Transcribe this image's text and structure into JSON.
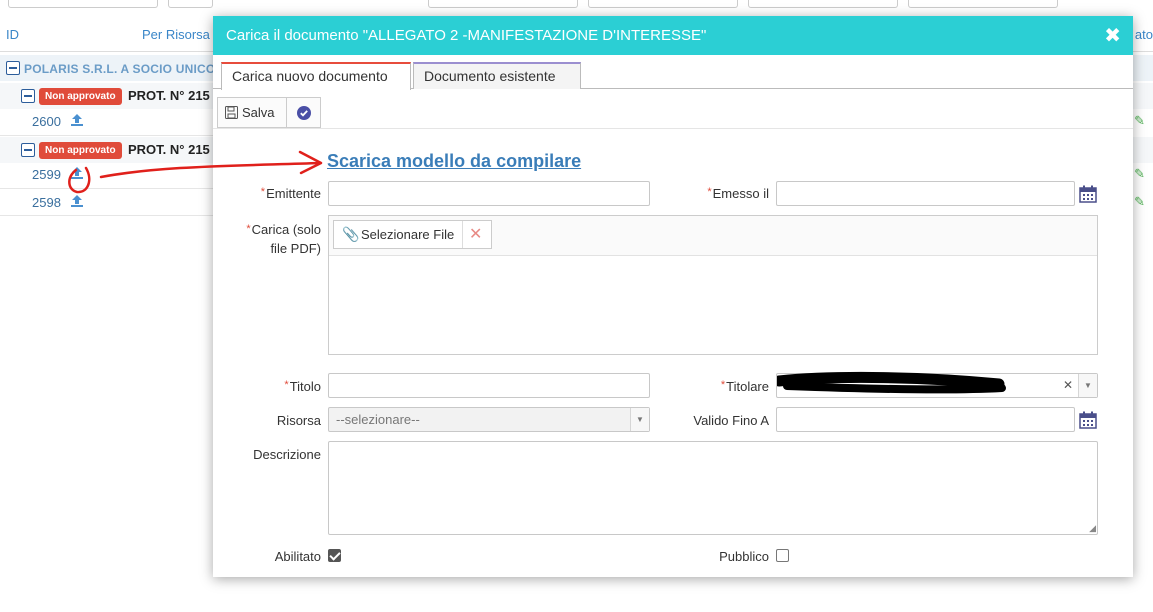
{
  "background": {
    "columns": {
      "id": "ID",
      "per_risorsa": "Per Risorsa",
      "right_label": "ato"
    },
    "group": {
      "label": "POLARIS S.R.L. A SOCIO UNICO"
    },
    "subgroups": [
      {
        "badge": "Non approvato",
        "prot": "PROT. N° 215"
      },
      {
        "badge": "Non approvato",
        "prot": "PROT. N° 215"
      }
    ],
    "rows": [
      "2600",
      "2599",
      "2598"
    ]
  },
  "modal": {
    "title": "Carica il documento \"ALLEGATO 2 -MANIFESTAZIONE D'INTERESSE\"",
    "close_glyph": "✖",
    "tabs": [
      "Carica nuovo documento",
      "Documento esistente"
    ],
    "toolbar": {
      "save_label": "Salva"
    },
    "download_link": "Scarica modello da compilare",
    "required_mark": "*",
    "fields": {
      "emittente": "Emittente",
      "emesso_il": "Emesso il",
      "carica": "Carica (solo file PDF)",
      "select_file": "Selezionare File",
      "titolo": "Titolo",
      "titolare": "Titolare",
      "risorsa": "Risorsa",
      "risorsa_placeholder": "--selezionare--",
      "valido_fino_a": "Valido Fino A",
      "descrizione": "Descrizione",
      "abilitato": "Abilitato",
      "pubblico": "Pubblico"
    },
    "checkbox_state": {
      "abilitato": true,
      "pubblico": false
    }
  },
  "colors": {
    "title_bar": "#2bcfd4",
    "badge": "#e04b3a",
    "link": "#3a7db8",
    "annotation": "#e0201b"
  }
}
